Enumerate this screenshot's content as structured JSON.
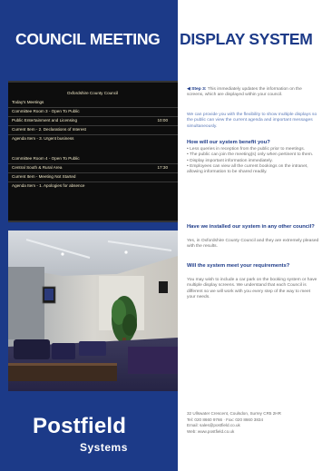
{
  "header": {
    "title_left": "COUNCIL MEETING",
    "title_right": "DISPLAY SYSTEM"
  },
  "board": {
    "heading": "Oxfordshire County Council",
    "rows": [
      {
        "label": "Today's Meetings",
        "value": ""
      },
      {
        "label": "Committee Room 3 - Open To Public",
        "value": ""
      },
      {
        "label": "Public Entertainment and Licensing",
        "value": "10:00"
      },
      {
        "label": "Current Item - 2. Declarations of Interest",
        "value": ""
      },
      {
        "label": "Agenda Item - 3. Urgent business",
        "value": ""
      },
      {
        "label": "Committee Room 4 - Open To Public",
        "value": ""
      },
      {
        "label": "Central South & Rural Area",
        "value": "17:30"
      },
      {
        "label": "Current Item - Meeting Not Started",
        "value": ""
      },
      {
        "label": "Agenda Item - 1. Apologies for absence",
        "value": ""
      }
    ]
  },
  "logo": {
    "main": "Postfield",
    "sub": "Systems"
  },
  "content": {
    "step_label": "Step 3:",
    "step_text": "This immediately updates the information on the screens, which are displayed within your council.",
    "flex_text": "We can provide you with the flexibility to show multiple displays so the public can view the current agenda and important messages simultaneously.",
    "q1": "How will our system benefit you?",
    "b1": "Less queries in reception from the public prior to meetings.",
    "b2": "The public can join the meeting(s) only when pertinent to them.",
    "b3": "Display important information immediately.",
    "b4": "Employees can view all the current bookings on the intranet, allowing information to be shared readily.",
    "q2": "Have we installed our system in any other council?",
    "a2": "Yes, in Oxfordshire County Council and they are extremely pleased with the results.",
    "q3": "Will the system meet your requirements?",
    "a3": "You may wish to include a car park on the booking system or have multiple display screens. We understand that each Council is different so we will work with you every step of the way to meet your needs."
  },
  "contact": {
    "address": "32 Ullswater Crescent, Coulsdon, Surrey CR5 2HR",
    "tel_fax": "Tel: 020 8660 9766 · Fax: 020 8660 3834",
    "email": "Email: sales@postfield.co.uk",
    "web": "Web: www.postfield.co.uk"
  },
  "colors": {
    "brand_blue": "#1c3a88",
    "board_text": "#f1e9c8"
  }
}
